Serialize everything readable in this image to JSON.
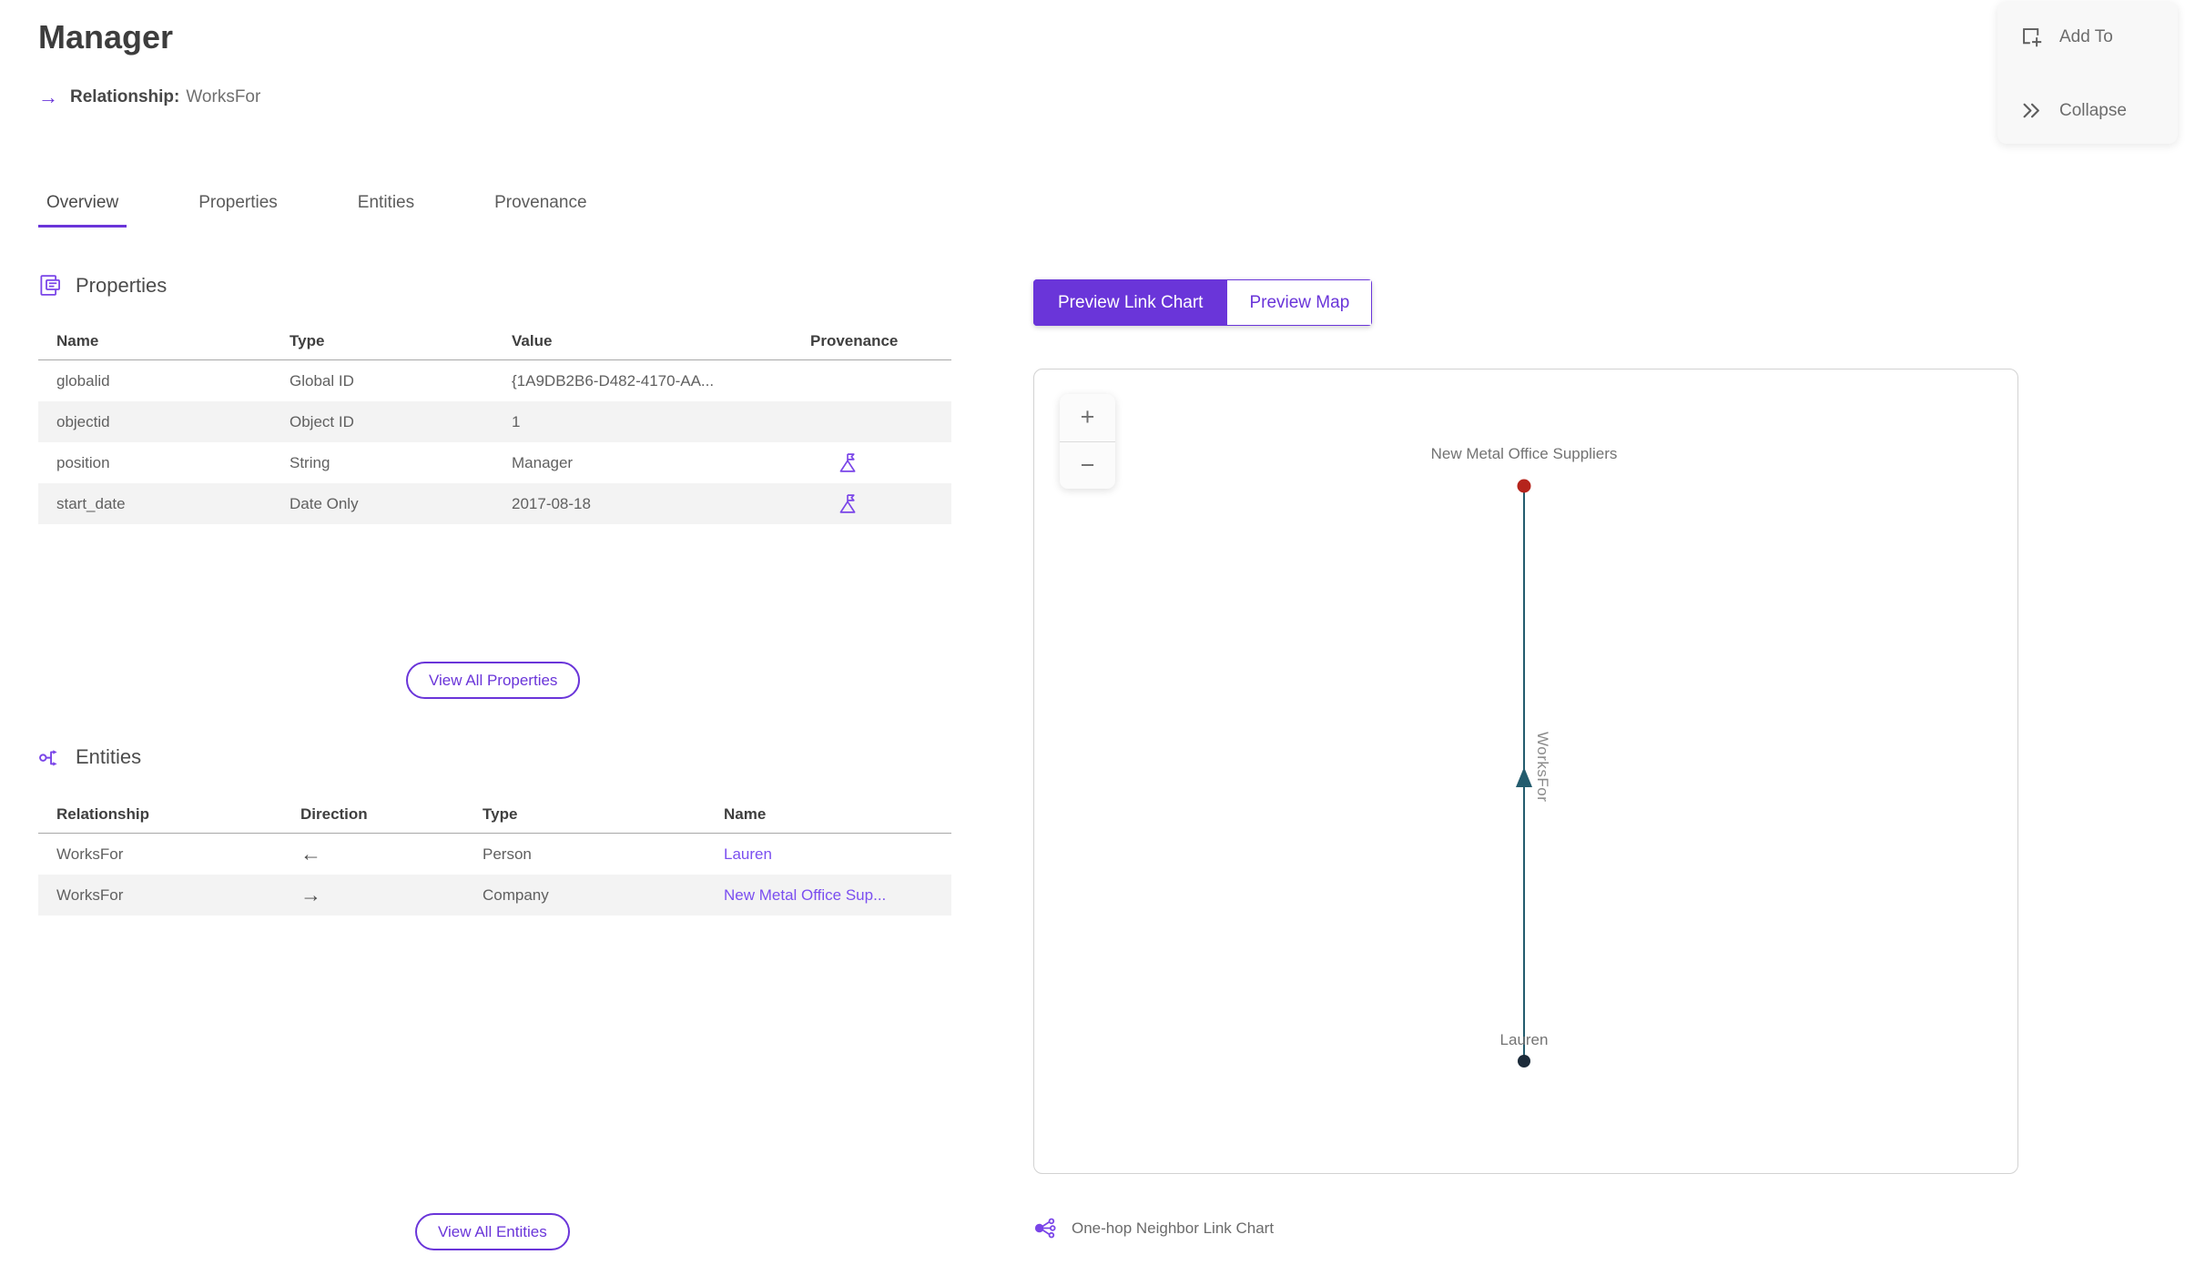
{
  "header": {
    "title": "Manager",
    "relationship_arrow": "→",
    "relationship_label": "Relationship:",
    "relationship_value": "WorksFor"
  },
  "panel_actions": {
    "add_to_label": "Add To",
    "collapse_label": "Collapse"
  },
  "tabs": [
    {
      "label": "Overview"
    },
    {
      "label": "Properties"
    },
    {
      "label": "Entities"
    },
    {
      "label": "Provenance"
    }
  ],
  "properties": {
    "section_title": "Properties",
    "headers": {
      "name": "Name",
      "type": "Type",
      "value": "Value",
      "provenance": "Provenance"
    },
    "rows": [
      {
        "name": "globalid",
        "type": "Global ID",
        "value": "{1A9DB2B6-D482-4170-AA..."
      },
      {
        "name": "objectid",
        "type": "Object ID",
        "value": "1"
      },
      {
        "name": "position",
        "type": "String",
        "value": "Manager"
      },
      {
        "name": "start_date",
        "type": "Date Only",
        "value": "2017-08-18"
      }
    ],
    "view_all_label": "View All Properties"
  },
  "entities": {
    "section_title": "Entities",
    "headers": {
      "relationship": "Relationship",
      "direction": "Direction",
      "type": "Type",
      "name": "Name"
    },
    "rows": [
      {
        "relationship": "WorksFor",
        "direction": "←",
        "type": "Person",
        "name": "Lauren"
      },
      {
        "relationship": "WorksFor",
        "direction": "→",
        "type": "Company",
        "name": "New Metal Office Sup..."
      }
    ],
    "view_all_label": "View All Entities"
  },
  "preview": {
    "toggle": {
      "link_chart": "Preview Link Chart",
      "map": "Preview Map"
    },
    "zoom_in": "+",
    "zoom_out": "−",
    "caption": "One-hop Neighbor Link Chart",
    "graph": {
      "top_node": {
        "label": "New Metal Office Suppliers",
        "color": "#b5241c"
      },
      "bottom_node": {
        "label": "Lauren",
        "color": "#1c2b3a"
      },
      "edge": {
        "label": "WorksFor",
        "color": "#235c6e"
      }
    }
  },
  "colors": {
    "accent": "#6a35d9",
    "link": "#7b4ff0"
  }
}
